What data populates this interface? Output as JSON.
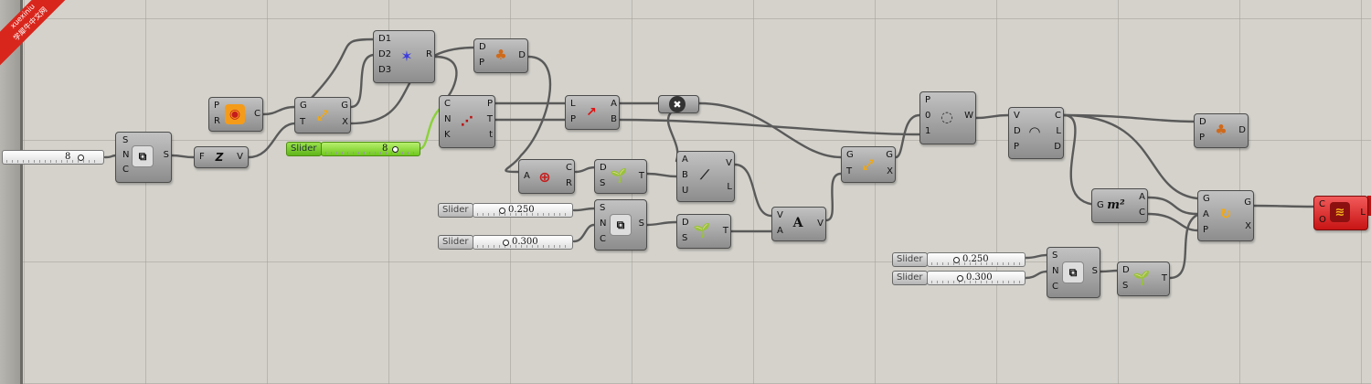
{
  "watermark": {
    "line1": "xuexiniu",
    "line2": "学犀牛中文网"
  },
  "sliders": [
    {
      "name": "",
      "value": "8"
    },
    {
      "name": "Slider",
      "value": "8"
    },
    {
      "name": "Slider",
      "value": "0.250"
    },
    {
      "name": "Slider",
      "value": "0.300"
    },
    {
      "name": "Slider",
      "value": "0.250"
    },
    {
      "name": "Slider",
      "value": "0.300"
    }
  ],
  "components": {
    "series": {
      "inputs": [
        "S",
        "N",
        "C"
      ],
      "outputs": [
        "S"
      ]
    },
    "expression": {
      "inputs": [
        "F"
      ],
      "outputs": [
        "V"
      ],
      "icon": "Z"
    },
    "circle": {
      "inputs": [
        "P",
        "R"
      ],
      "outputs": [
        "C"
      ]
    },
    "evaluate_curve_1": {
      "inputs": [
        "G",
        "T"
      ],
      "outputs": [
        "G",
        "X"
      ]
    },
    "vector_display": {
      "inputs": [
        "D1",
        "D2",
        "D3"
      ],
      "outputs": [
        "R"
      ]
    },
    "perp_frames": {
      "inputs": [
        "D",
        "P"
      ],
      "outputs": [
        "D"
      ]
    },
    "curve_params": {
      "inputs": [
        "C",
        "N",
        "K"
      ],
      "outputs": [
        "P",
        "T",
        "t"
      ]
    },
    "shift_list": {
      "inputs": [
        "L",
        "P"
      ],
      "outputs": [
        "A",
        "B"
      ]
    },
    "cull": {
      "icon": "✖"
    },
    "circle_cnr": {
      "inputs": [
        "A"
      ],
      "outputs": [
        "C",
        "R"
      ]
    },
    "sprout_1": {
      "inputs": [
        "D",
        "S"
      ],
      "outputs": [
        "T"
      ]
    },
    "line_abu": {
      "inputs": [
        "A",
        "B",
        "U"
      ],
      "outputs": [
        "V",
        "L"
      ]
    },
    "series_2": {
      "inputs": [
        "S",
        "N",
        "C"
      ],
      "outputs": [
        "S"
      ]
    },
    "sprout_2": {
      "inputs": [
        "D",
        "S"
      ],
      "outputs": [
        "T"
      ]
    },
    "amplitude": {
      "inputs": [
        "V",
        "A"
      ],
      "outputs": [
        "V"
      ],
      "icon": "A"
    },
    "evaluate_curve_2": {
      "inputs": [
        "G",
        "T"
      ],
      "outputs": [
        "G",
        "X"
      ]
    },
    "loft": {
      "inputs": [
        "P",
        "0",
        "1"
      ],
      "outputs": [
        "W"
      ]
    },
    "curve_cld": {
      "inputs": [
        "V",
        "D",
        "P"
      ],
      "outputs": [
        "C",
        "L",
        "D"
      ]
    },
    "perp_frames_2": {
      "inputs": [
        "D",
        "P"
      ],
      "outputs": [
        "D"
      ]
    },
    "area": {
      "inputs": [
        "G"
      ],
      "outputs": [
        "A",
        "C"
      ],
      "icon": "m²"
    },
    "orient": {
      "inputs": [
        "G",
        "A",
        "P"
      ],
      "outputs": [
        "G",
        "X"
      ]
    },
    "series_3": {
      "inputs": [
        "S",
        "N",
        "C"
      ],
      "outputs": [
        "S"
      ]
    },
    "sprout_3": {
      "inputs": [
        "D",
        "S"
      ],
      "outputs": [
        "T"
      ]
    },
    "custom_preview": {
      "inputs": [
        "C",
        "O"
      ],
      "outputs": [
        "L"
      ]
    }
  }
}
